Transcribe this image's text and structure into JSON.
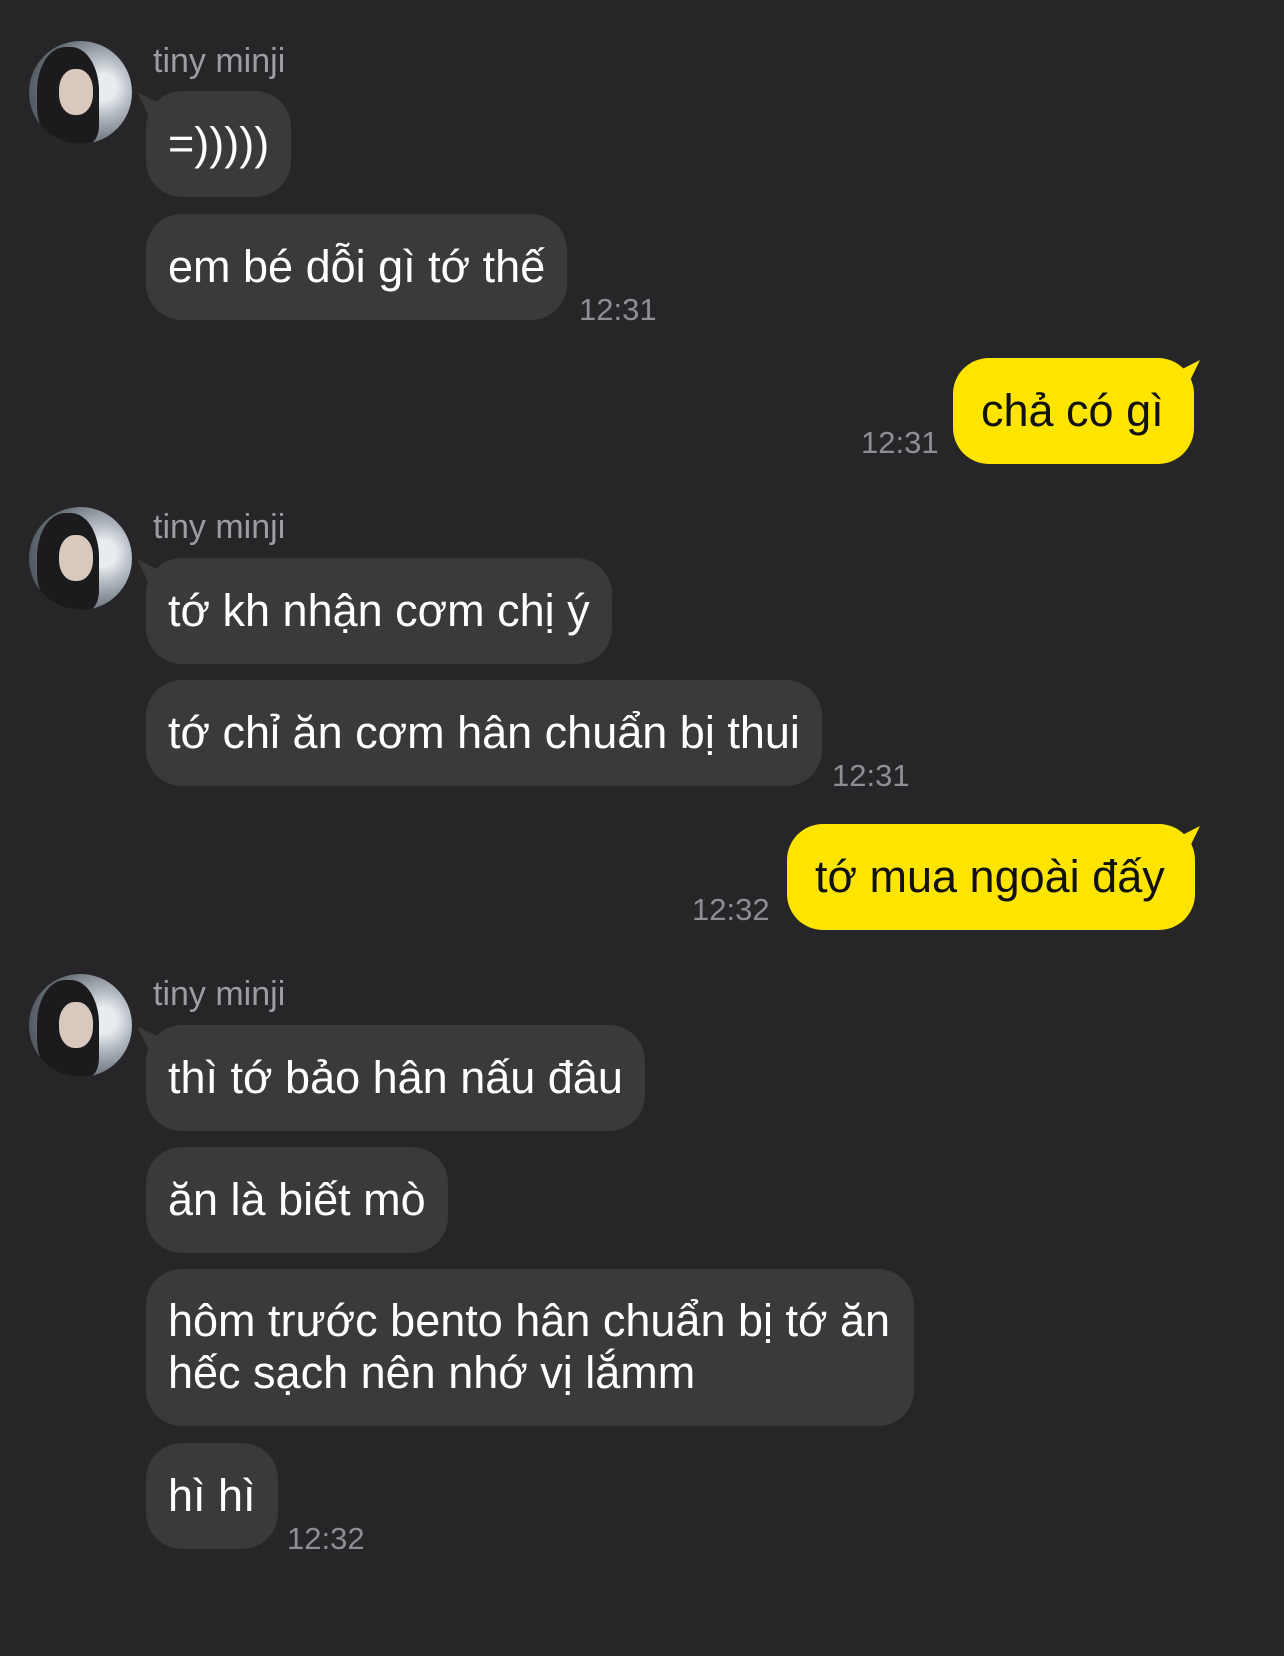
{
  "chat": {
    "sender_name": "tiny minji",
    "groups": [
      {
        "messages": [
          "=)))))",
          "em bé dỗi gì tớ thế"
        ],
        "time": "12:31"
      },
      {
        "me": "chả có gì",
        "time": "12:31"
      },
      {
        "messages": [
          "tớ kh nhận cơm chị ý",
          "tớ chỉ ăn cơm hân chuẩn bị thui"
        ],
        "time": "12:31"
      },
      {
        "me": "tớ mua ngoài đấy",
        "time": "12:32"
      },
      {
        "messages": [
          "thì tớ bảo hân nấu đâu",
          "ăn là biết mò",
          "hôm trước bento hân chuẩn bị tớ ăn hếc sạch nên nhớ vị lắmm",
          "hì hì"
        ],
        "time": "12:32"
      }
    ]
  },
  "colors": {
    "background": "#262628",
    "incoming_bubble": "#3a3a3d",
    "outgoing_bubble": "#fee500",
    "timestamp": "#8e8e93",
    "sender_name": "#9c9ca1"
  }
}
